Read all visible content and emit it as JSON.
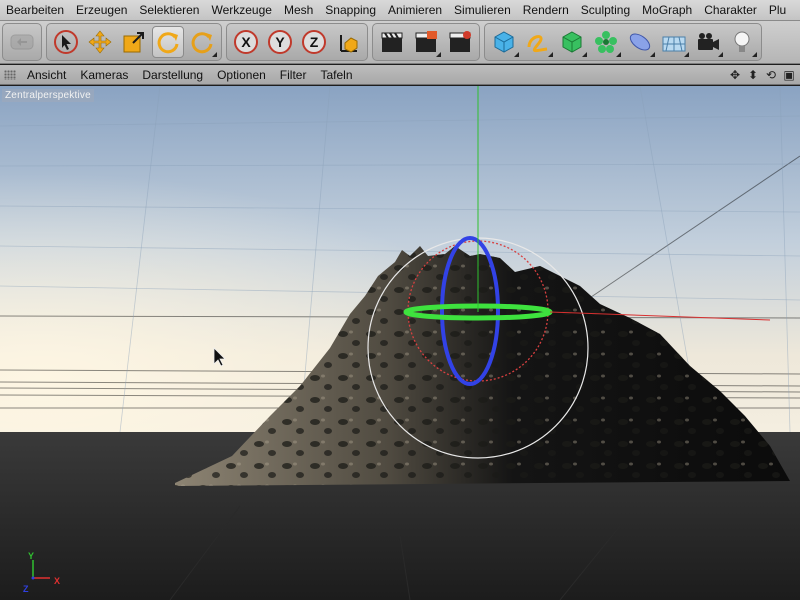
{
  "menu": {
    "items": [
      "Bearbeiten",
      "Erzeugen",
      "Selektieren",
      "Werkzeuge",
      "Mesh",
      "Snapping",
      "Animieren",
      "Simulieren",
      "Rendern",
      "Sculpting",
      "MoGraph",
      "Charakter",
      "Plu"
    ]
  },
  "toolbar": {
    "axis_x": "X",
    "axis_y": "Y",
    "axis_z": "Z"
  },
  "view_menu": {
    "items": [
      "Ansicht",
      "Kameras",
      "Darstellung",
      "Optionen",
      "Filter",
      "Tafeln"
    ]
  },
  "viewport": {
    "label": "Zentralperspektive",
    "axis_y": "Y",
    "axis_x": "X",
    "axis_z": "Z"
  },
  "colors": {
    "x_axis": "#e03030",
    "y_axis": "#30c030",
    "z_axis": "#3040e0",
    "sky_top": "#8fa7c4",
    "sky_horizon": "#f3ecdc",
    "ground": "#262626"
  }
}
